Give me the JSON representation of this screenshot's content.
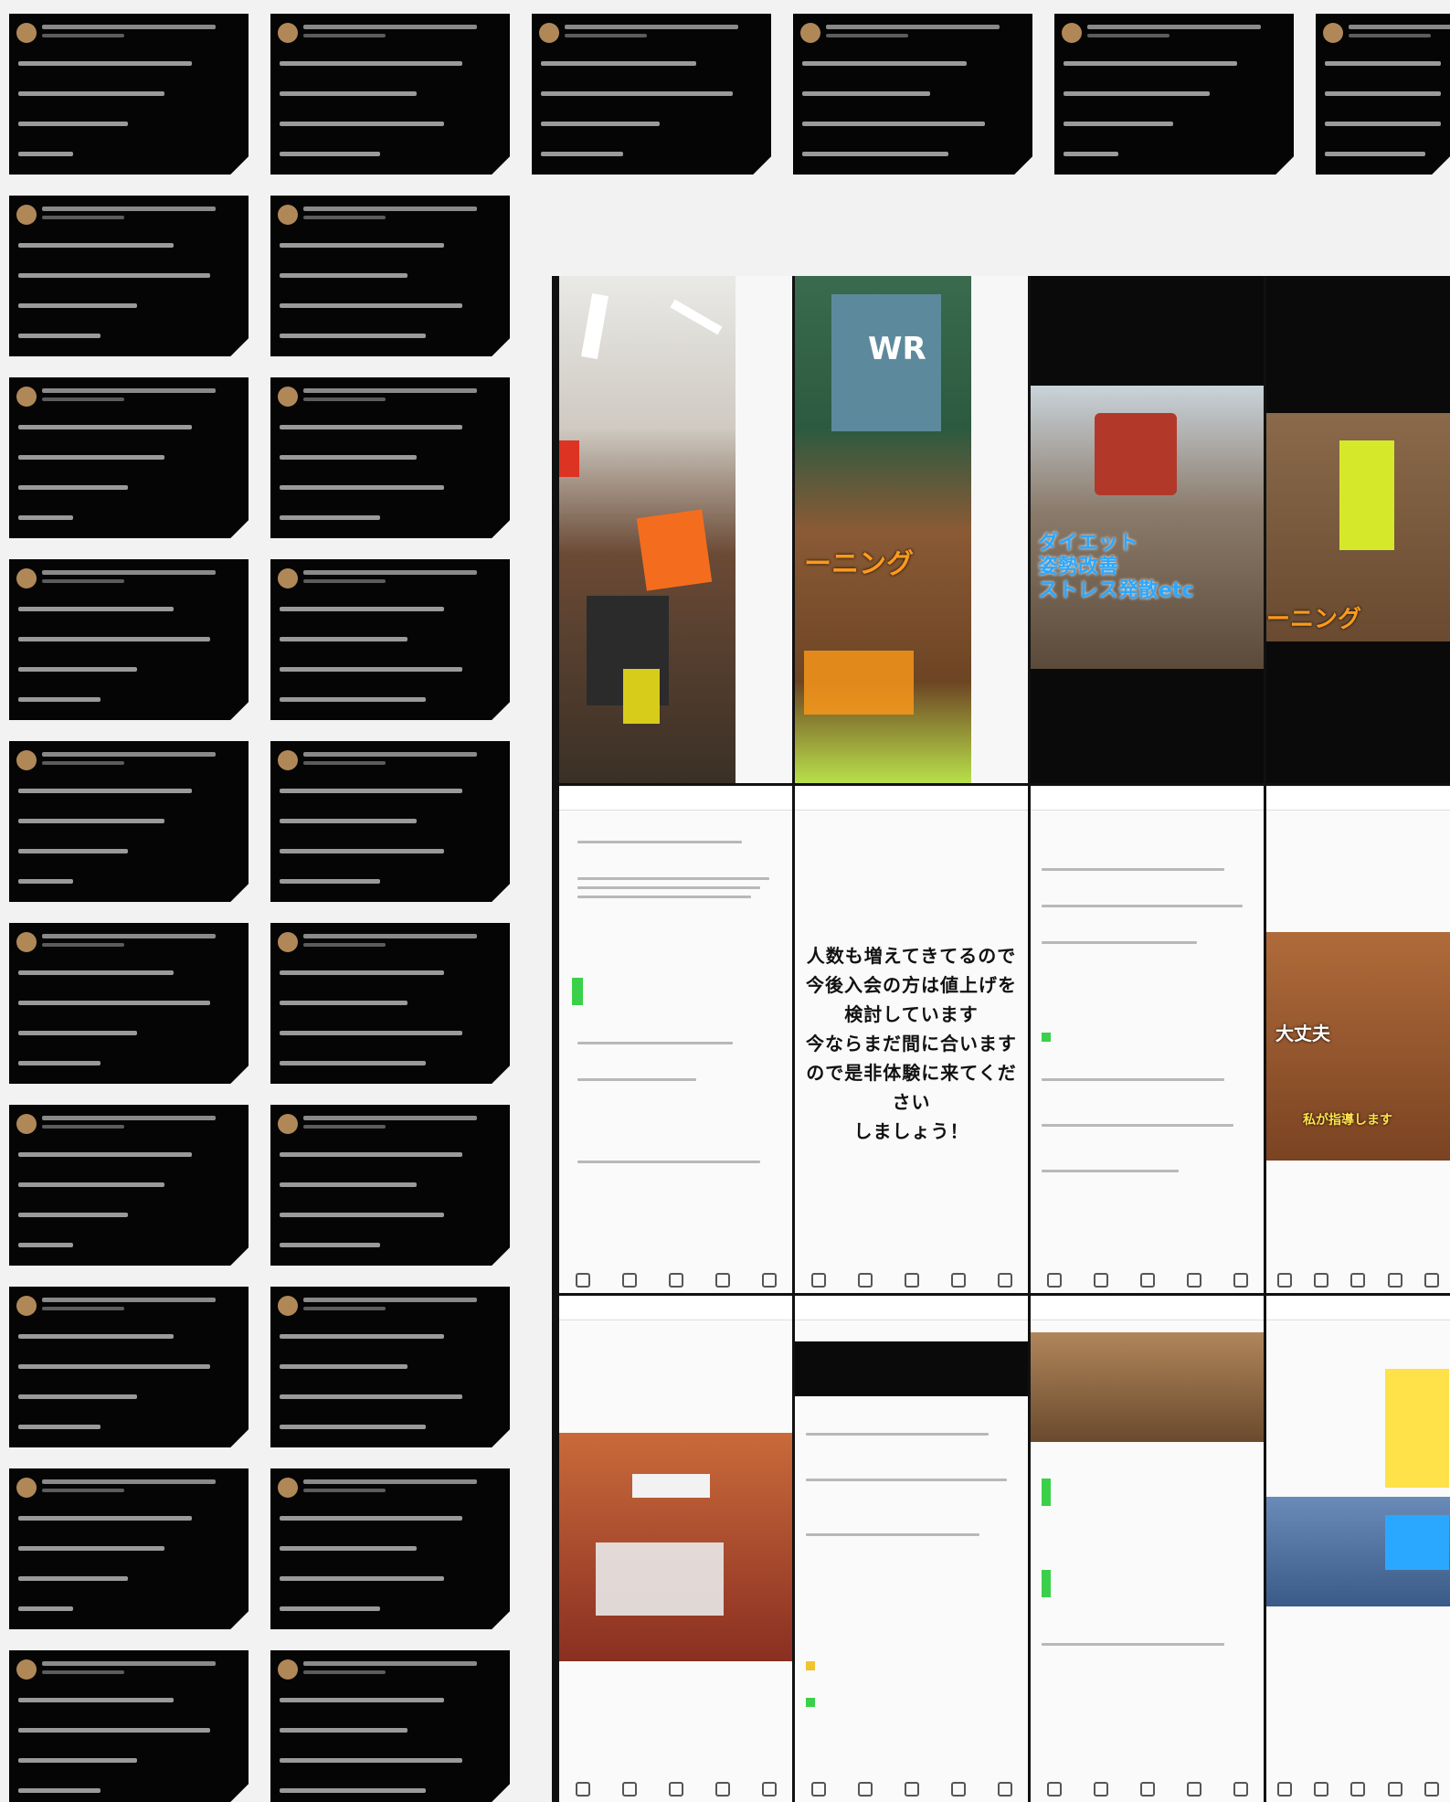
{
  "colors": {
    "page_bg": "#f2f2f2",
    "card_bg": "#050505",
    "overlay_orange": "#ff9a1a",
    "overlay_blue": "#2aa8ff",
    "accent_green": "#3bd04a"
  },
  "collage": {
    "tiles": [
      {
        "id": "gym-photo-1",
        "icon": "gym-photo"
      },
      {
        "id": "gym-photo-2",
        "icon": "trainer-photo",
        "overlay": "ーニング"
      },
      {
        "id": "gym-photo-3",
        "icon": "trainer-photo",
        "overlay_lines": [
          "ダイエット",
          "姿勢改善",
          "ストレス発散etc"
        ]
      },
      {
        "id": "gym-photo-4",
        "icon": "trainer-photo",
        "overlay": "ーニング"
      },
      {
        "id": "post-text-1",
        "lines": [
          "人数も増えてきてるので",
          "今後入会の方は値上げを",
          "検討しています",
          "今ならまだ間に合います",
          "ので是非体験に来てください",
          "しましょう！"
        ]
      },
      {
        "id": "post-photo-1",
        "overlay": "大丈夫",
        "overlay2": "私が指導します"
      }
    ]
  }
}
